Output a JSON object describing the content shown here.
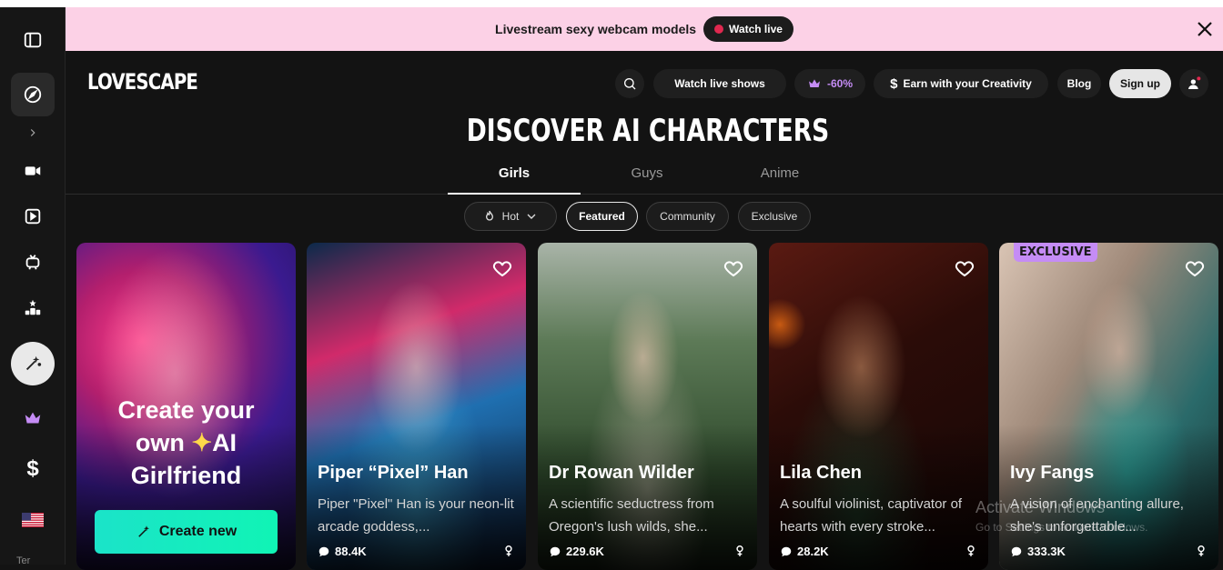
{
  "banner": {
    "text": "Livestream sexy webcam models",
    "watch_label": "Watch live"
  },
  "header": {
    "logo": "LOVESCAPE",
    "watch_shows": "Watch live shows",
    "discount": "-60%",
    "earn": "Earn with your Creativity",
    "blog": "Blog",
    "signup": "Sign up"
  },
  "page": {
    "title": "DISCOVER AI CHARACTERS"
  },
  "tabs": [
    {
      "label": "Girls"
    },
    {
      "label": "Guys"
    },
    {
      "label": "Anime"
    }
  ],
  "chips": {
    "hot": "Hot",
    "featured": "Featured",
    "community": "Community",
    "exclusive": "Exclusive"
  },
  "create_card": {
    "line1": "Create your",
    "line2a": "own",
    "line2b": "AI",
    "line3": "Girlfriend",
    "button": "Create new"
  },
  "cards": [
    {
      "name": "Piper “Pixel” Han",
      "description": "Piper \"Pixel\" Han is your neon-lit arcade goddess,...",
      "count": "88.4K"
    },
    {
      "name": "Dr Rowan Wilder",
      "description": "A scientific seductress from Oregon's lush wilds, she...",
      "count": "229.6K"
    },
    {
      "name": "Lila Chen",
      "description": "A soulful violinist, captivator of hearts with every stroke...",
      "count": "28.2K"
    },
    {
      "name": "Ivy Fangs",
      "description": "A vision of enchanting allure, she's unforgettable...",
      "count": "333.3K",
      "badge": "EXCLUSIVE"
    }
  ],
  "watermark": {
    "line1": "Activate Windows",
    "line2": "Go to Settings to activate Windows."
  },
  "sidebar": {
    "footer": "Ter"
  },
  "colors": {
    "banner_bg": "#fcd1e6",
    "accent_purple": "#c58cf5",
    "create_green": "#1be3c9",
    "live_red": "#e0284f"
  }
}
